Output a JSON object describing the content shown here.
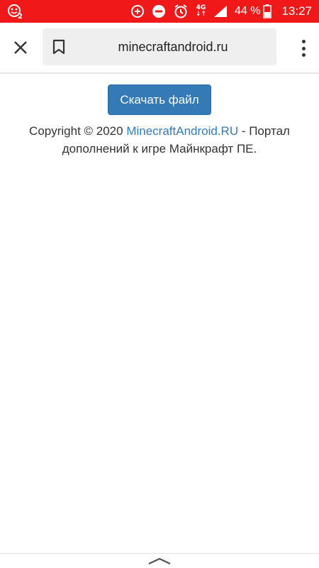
{
  "status_bar": {
    "battery_percent": "44 %",
    "time": "13:27",
    "network_type": "4G",
    "background_color": "#f01818",
    "icons": [
      "notification-badge-icon",
      "data-saver-icon",
      "do-not-disturb-icon",
      "alarm-icon",
      "network-4g-icon",
      "signal-icon",
      "battery-icon"
    ]
  },
  "toolbar": {
    "url": "minecraftandroid.ru",
    "icons": [
      "close-icon",
      "bookmark-icon",
      "more-vert-icon"
    ]
  },
  "main": {
    "download_button_label": "Скачать файл",
    "download_button_color": "#337ab7",
    "footer": {
      "prefix": "Copyright © 2020 ",
      "link_text": "MinecraftAndroid.RU",
      "suffix": " - Портал дополнений к игре Майнкрафт ПЕ."
    }
  },
  "bottom_bar": {
    "icon": "chevron-up-icon"
  }
}
